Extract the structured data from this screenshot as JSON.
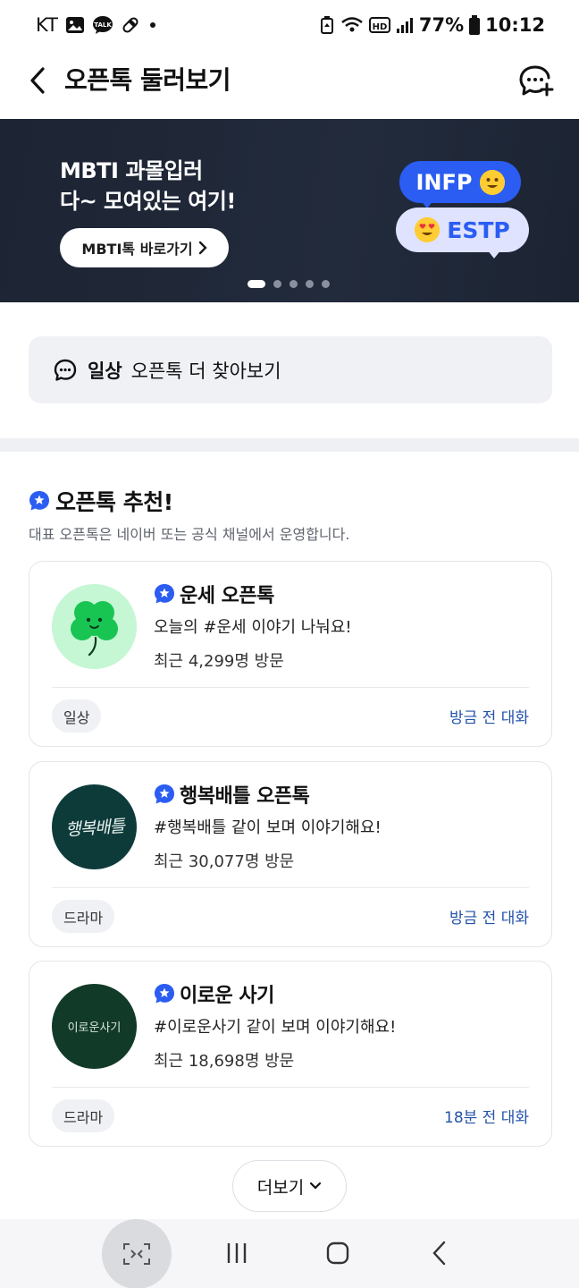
{
  "status_bar": {
    "carrier": "KT",
    "battery": "77%",
    "time": "10:12"
  },
  "header": {
    "title": "오픈톡 둘러보기",
    "back_icon": "chevron-left-icon",
    "new_chat_icon": "chat-plus-icon"
  },
  "banner": {
    "line1": "MBTI 과몰입러",
    "line2": "다~ 모여있는 여기!",
    "button_label": "MBTI톡 바로가기",
    "bubble1": "INFP",
    "bubble2": "ESTP",
    "page_count": 5,
    "current_page": 1,
    "bg_color": "#1f2737"
  },
  "explore": {
    "category": "일상",
    "text": "오픈톡 더 찾아보기"
  },
  "recommend": {
    "title": "오픈톡 추천!",
    "subtitle": "대표 오픈톡은 네이버 또는 공식 채널에서 운영합니다.",
    "accent": "#2b5df2",
    "items": [
      {
        "name": "운세 오픈톡",
        "desc": "오늘의 #운세 이야기 나눠요!",
        "visits": "최근 4,299명 방문",
        "tag": "일상",
        "activity": "방금 전 대화",
        "thumb_icon": "clover-icon"
      },
      {
        "name": "행복배틀 오픈톡",
        "desc": "#행복배틀 같이 보며 이야기해요!",
        "visits": "최근 30,077명 방문",
        "tag": "드라마",
        "activity": "방금 전 대화",
        "thumb_text": "행복배틀"
      },
      {
        "name": "이로운 사기",
        "desc": "#이로운사기 같이 보며 이야기해요!",
        "visits": "최근 18,698명 방문",
        "tag": "드라마",
        "activity": "18분 전 대화",
        "thumb_text": "이로운사기"
      }
    ],
    "more_label": "더보기"
  },
  "nav": {
    "items": [
      "scan-icon",
      "recent-apps-icon",
      "home-icon",
      "back-icon"
    ]
  }
}
